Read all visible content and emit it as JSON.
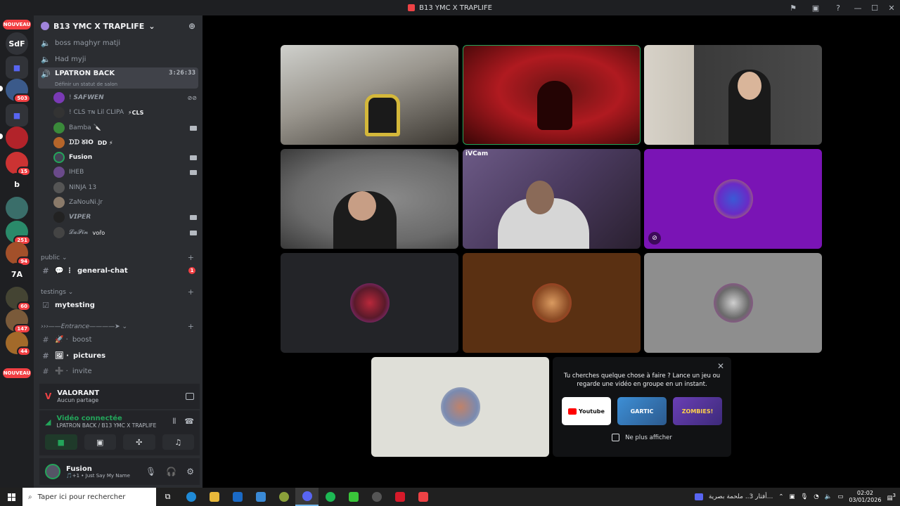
{
  "window": {
    "title": "B13 YMC X TRAPLIFE"
  },
  "rail": {
    "nouveau_label": "NOUVEAU",
    "sdf_label": "SdF",
    "b_label": "b",
    "ta_label": "7A",
    "badges": [
      "503",
      "15",
      "251",
      "94",
      "60",
      "147",
      "44"
    ]
  },
  "guild": {
    "name": "B13 YMC X TRAPLIFE"
  },
  "channels": {
    "voice1": "boss maghyr matji",
    "voice2": "Had myji",
    "active_voice": "LPATRON BACK",
    "active_voice_sub": "Définir un statut de salon",
    "active_timer": "3:26:33"
  },
  "members": [
    {
      "name": "! 𝙎𝘼𝙁𝙒𝙀𝙉"
    },
    {
      "name": "! CLS ᴛɴ Lil CLIPA",
      "tag": "⚡CLS"
    },
    {
      "name": "Bamba 🔪"
    },
    {
      "name": "ᗪᗪ ᘜIO",
      "tag": "DD ⚡"
    },
    {
      "name": "Fusion"
    },
    {
      "name": "IHEB"
    },
    {
      "name": "NINJA 13"
    },
    {
      "name": "ZaNouNi.Jr"
    },
    {
      "name": "𝙑𝙄𝙋𝙀𝙍"
    },
    {
      "name": "𝓛𝓪𝓟𝓲𝓷",
      "tag": "vořo"
    }
  ],
  "categories": {
    "public": "public",
    "general_chat": "general-chat",
    "general_chat_unread": "1",
    "testings": "testings",
    "mytesting": "mytesting",
    "entrance": "›››——Entrance————➤",
    "boost": "boost",
    "pictures": "pictures",
    "invite": "invite"
  },
  "activity_panel": {
    "game": "VALORANT",
    "status": "Aucun partage"
  },
  "voice_panel": {
    "status": "Vidéo connectée",
    "location": "LPATRON BACK / B13 YMC X TRAPLIFE"
  },
  "user_panel": {
    "name": "Fusion",
    "status": "Just Say My Name"
  },
  "tiles": {
    "ivcam_label": "iVCam"
  },
  "suggestion": {
    "message": "Tu cherches quelque chose à faire ? Lance un jeu ou regarde une vidéo en groupe en un instant.",
    "youtube": "Youtube",
    "gartic": "GARTIC",
    "zombies": "ZOMBIES!",
    "dont_show": "Ne plus afficher"
  },
  "taskbar": {
    "search_placeholder": "Taper ici pour rechercher",
    "notification_text": "أفتار 3.. ملحمة بصرية...",
    "time": "02:02",
    "date": "03/01/2026",
    "notif_count": "3"
  },
  "colors": {
    "accent": "#5865f2",
    "green": "#23a55a",
    "red": "#f23f43"
  }
}
